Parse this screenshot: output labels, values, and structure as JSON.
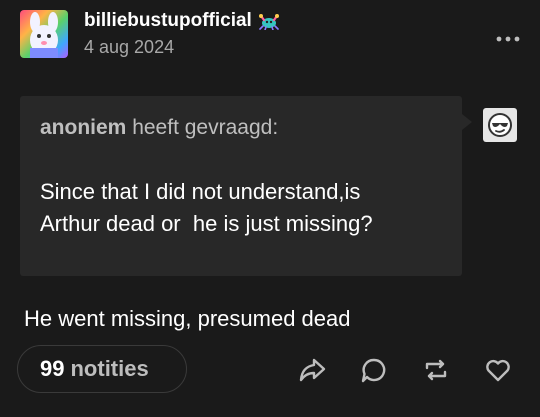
{
  "post": {
    "username": "billiebustupofficial",
    "date": "4 aug 2024",
    "ask": {
      "asker": "anoniem",
      "asked_label": "heeft gevraagd:",
      "question": "Since that I did not understand,is\nArthur dead or  he is just missing?"
    },
    "answer": "He went missing, presumed dead",
    "notes": {
      "count": "99",
      "label": "notities"
    }
  },
  "icons": {
    "more": "more-options-icon",
    "share": "share-icon",
    "reply": "reply-icon",
    "reblog": "reblog-icon",
    "like": "heart-icon",
    "badge": "crab-badge-icon",
    "anon": "anonymous-sunglasses-icon"
  },
  "colors": {
    "background": "#1a1a1a",
    "ask_background": "#282828",
    "muted_text": "#a8a8a8",
    "icon": "#bdbdbd"
  }
}
